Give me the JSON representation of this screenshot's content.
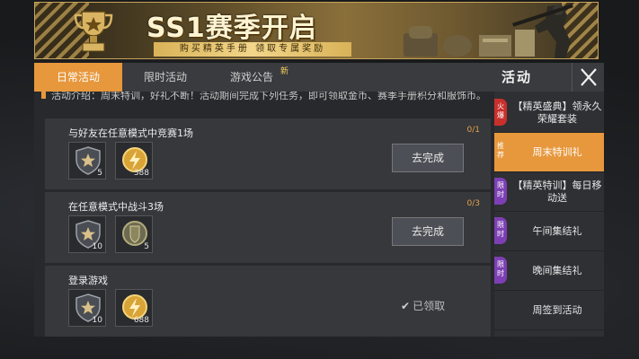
{
  "banner": {
    "title": "SS1赛季开启",
    "subtitle": "购买精英手册 领取专属奖励"
  },
  "tabs": [
    {
      "label": "日常活动",
      "active": true
    },
    {
      "label": "限时活动",
      "active": false
    },
    {
      "label": "游戏公告",
      "active": false,
      "badge": "新"
    }
  ],
  "panel": {
    "title": "活动",
    "close_icon": "close-icon"
  },
  "intro": {
    "text": "活动介绍：周末特训，好礼不断！活动期间完成下列任务，即可领取金币、赛季手册积分和服饰币。"
  },
  "tasks": [
    {
      "title": "与好友在任意模式中竞赛1场",
      "progress": "0/1",
      "rewards": [
        {
          "icon": "star-shield-icon",
          "count": "5"
        },
        {
          "icon": "lightning-coin-icon",
          "count": "388"
        }
      ],
      "action": "去完成",
      "claimed": false
    },
    {
      "title": "在任意模式中战斗3场",
      "progress": "0/3",
      "rewards": [
        {
          "icon": "star-shield-icon",
          "count": "10"
        },
        {
          "icon": "bp-coin-icon",
          "count": "5"
        }
      ],
      "action": "去完成",
      "claimed": false
    },
    {
      "title": "登录游戏",
      "progress": "",
      "rewards": [
        {
          "icon": "star-shield-icon",
          "count": "10"
        },
        {
          "icon": "lightning-coin-icon",
          "count": "688"
        }
      ],
      "action": "已领取",
      "claimed": true
    }
  ],
  "sidebar": [
    {
      "badge": "火爆",
      "label": "【精英盛典】领永久荣耀套装",
      "active": false
    },
    {
      "badge": "推荐",
      "label": "周末特训礼",
      "active": true
    },
    {
      "badge": "限时",
      "label": "【精英特训】每日移动送",
      "active": false
    },
    {
      "badge": "限时",
      "label": "午间集结礼",
      "active": false
    },
    {
      "badge": "限时",
      "label": "晚间集结礼",
      "active": false
    },
    {
      "badge": "",
      "label": "周签到活动",
      "active": false
    }
  ],
  "colors": {
    "accent": "#e7973c",
    "progress": "#e7a24a",
    "hot": "#c9302c",
    "limited": "#7d3fb3"
  }
}
